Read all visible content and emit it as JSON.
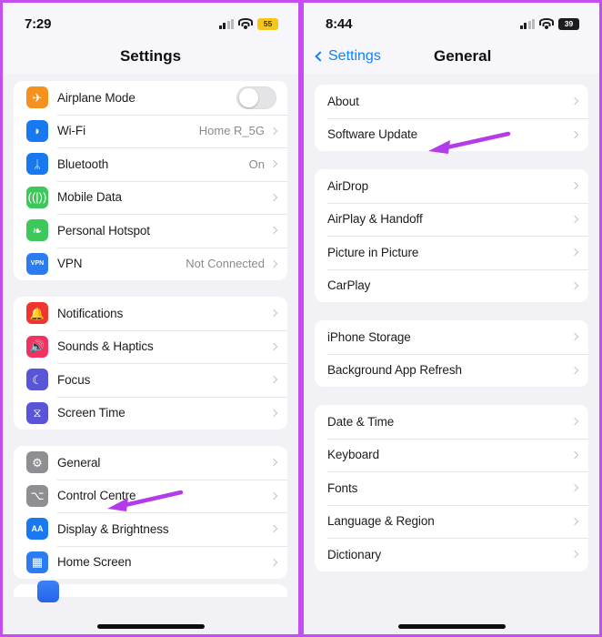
{
  "theme": {
    "border": "#c44ef0",
    "page_bg": "#f2f1f6",
    "card_bg": "#ffffff",
    "accent_blue": "#0a84ff",
    "arrow_color": "#b43bea",
    "battery_low_power": "#f5c518",
    "battery_dark": "#1c1c1e"
  },
  "left_panel": {
    "status": {
      "time": "7:29",
      "signal_icon": "cellular-bars-icon",
      "wifi_icon": "wifi-icon",
      "battery_label": "55",
      "battery_style": "yellow"
    },
    "nav": {
      "title": "Settings"
    },
    "groups": [
      {
        "id": "connectivity",
        "rows": [
          {
            "label": "Airplane Mode",
            "icon": "airplane-icon",
            "icon_color": "#f5911e",
            "glyph": "✈",
            "control": "toggle",
            "toggle_on": false
          },
          {
            "label": "Wi-Fi",
            "icon": "wifi-icon",
            "icon_color": "#1878f0",
            "glyph": "◑",
            "value": "Home R_5G",
            "control": "chevron"
          },
          {
            "label": "Bluetooth",
            "icon": "bluetooth-icon",
            "icon_color": "#1878f0",
            "glyph": "ᛦ",
            "value": "On",
            "control": "chevron"
          },
          {
            "label": "Mobile Data",
            "icon": "mobile-data-icon",
            "icon_color": "#3cc85a",
            "glyph": "ʃ",
            "control": "chevron"
          },
          {
            "label": "Personal Hotspot",
            "icon": "hotspot-icon",
            "icon_color": "#3cc85a",
            "glyph": "❀",
            "control": "chevron"
          },
          {
            "label": "VPN",
            "icon": "vpn-icon",
            "icon_color": "#2a7cf0",
            "glyph": "VPN",
            "value": "Not Connected",
            "control": "chevron"
          }
        ]
      },
      {
        "id": "alerts",
        "rows": [
          {
            "label": "Notifications",
            "icon": "notifications-bell-icon",
            "icon_color": "#f1342e",
            "glyph": "▲",
            "control": "chevron"
          },
          {
            "label": "Sounds & Haptics",
            "icon": "sounds-speaker-icon",
            "icon_color": "#f1345f",
            "glyph": "◀",
            "control": "chevron"
          },
          {
            "label": "Focus",
            "icon": "focus-moon-icon",
            "icon_color": "#5855d6",
            "glyph": "☾",
            "control": "chevron"
          },
          {
            "label": "Screen Time",
            "icon": "screen-time-hourglass-icon",
            "icon_color": "#5855d6",
            "glyph": "⧖",
            "control": "chevron"
          }
        ]
      },
      {
        "id": "system",
        "rows": [
          {
            "label": "General",
            "icon": "gear-icon",
            "icon_color": "#8e8e93",
            "glyph": "⚙",
            "control": "chevron",
            "annotated": true
          },
          {
            "label": "Control Centre",
            "icon": "control-centre-icon",
            "icon_color": "#8e8e93",
            "glyph": "⎇",
            "control": "chevron"
          },
          {
            "label": "Display & Brightness",
            "icon": "display-brightness-icon",
            "icon_color": "#1878f0",
            "glyph": "AA",
            "control": "chevron"
          },
          {
            "label": "Home Screen",
            "icon": "home-screen-icon",
            "icon_color": "#2a7cf0",
            "glyph": "∷",
            "control": "chevron"
          }
        ]
      }
    ],
    "annotation": {
      "target": "General",
      "type": "arrow-left"
    }
  },
  "right_panel": {
    "status": {
      "time": "8:44",
      "signal_icon": "cellular-bars-icon",
      "wifi_icon": "wifi-icon",
      "battery_label": "39",
      "battery_style": "dark"
    },
    "nav": {
      "back_label": "Settings",
      "back_icon": "chevron-left-icon",
      "title": "General"
    },
    "groups": [
      {
        "id": "about-update",
        "rows": [
          {
            "label": "About",
            "control": "chevron"
          },
          {
            "label": "Software Update",
            "control": "chevron",
            "annotated": true
          }
        ]
      },
      {
        "id": "sharing",
        "rows": [
          {
            "label": "AirDrop",
            "control": "chevron"
          },
          {
            "label": "AirPlay & Handoff",
            "control": "chevron"
          },
          {
            "label": "Picture in Picture",
            "control": "chevron"
          },
          {
            "label": "CarPlay",
            "control": "chevron"
          }
        ]
      },
      {
        "id": "storage",
        "rows": [
          {
            "label": "iPhone Storage",
            "control": "chevron"
          },
          {
            "label": "Background App Refresh",
            "control": "chevron"
          }
        ]
      },
      {
        "id": "locale",
        "rows": [
          {
            "label": "Date & Time",
            "control": "chevron"
          },
          {
            "label": "Keyboard",
            "control": "chevron"
          },
          {
            "label": "Fonts",
            "control": "chevron"
          },
          {
            "label": "Language & Region",
            "control": "chevron"
          },
          {
            "label": "Dictionary",
            "control": "chevron"
          }
        ]
      }
    ],
    "annotation": {
      "target": "Software Update",
      "type": "arrow-left"
    }
  }
}
